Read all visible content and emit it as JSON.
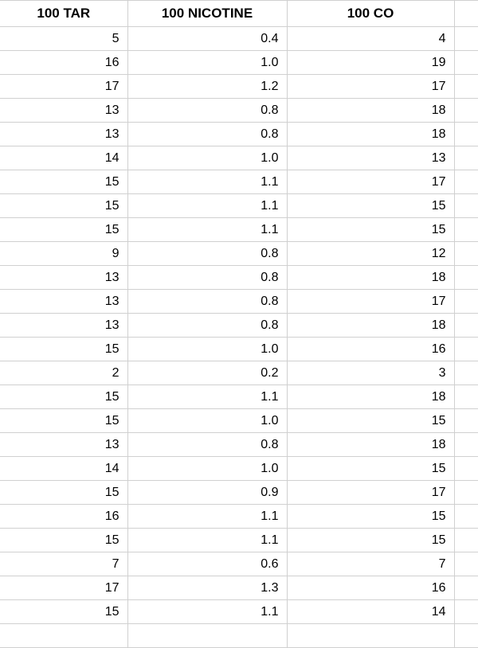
{
  "table": {
    "headers": [
      "100 TAR",
      "100 NICOTINE",
      "100 CO"
    ],
    "rows": [
      {
        "tar": "5",
        "nicotine": "0.4",
        "co": "4"
      },
      {
        "tar": "16",
        "nicotine": "1.0",
        "co": "19"
      },
      {
        "tar": "17",
        "nicotine": "1.2",
        "co": "17"
      },
      {
        "tar": "13",
        "nicotine": "0.8",
        "co": "18"
      },
      {
        "tar": "13",
        "nicotine": "0.8",
        "co": "18"
      },
      {
        "tar": "14",
        "nicotine": "1.0",
        "co": "13"
      },
      {
        "tar": "15",
        "nicotine": "1.1",
        "co": "17"
      },
      {
        "tar": "15",
        "nicotine": "1.1",
        "co": "15"
      },
      {
        "tar": "15",
        "nicotine": "1.1",
        "co": "15"
      },
      {
        "tar": "9",
        "nicotine": "0.8",
        "co": "12"
      },
      {
        "tar": "13",
        "nicotine": "0.8",
        "co": "18"
      },
      {
        "tar": "13",
        "nicotine": "0.8",
        "co": "17"
      },
      {
        "tar": "13",
        "nicotine": "0.8",
        "co": "18"
      },
      {
        "tar": "15",
        "nicotine": "1.0",
        "co": "16"
      },
      {
        "tar": "2",
        "nicotine": "0.2",
        "co": "3"
      },
      {
        "tar": "15",
        "nicotine": "1.1",
        "co": "18"
      },
      {
        "tar": "15",
        "nicotine": "1.0",
        "co": "15"
      },
      {
        "tar": "13",
        "nicotine": "0.8",
        "co": "18"
      },
      {
        "tar": "14",
        "nicotine": "1.0",
        "co": "15"
      },
      {
        "tar": "15",
        "nicotine": "0.9",
        "co": "17"
      },
      {
        "tar": "16",
        "nicotine": "1.1",
        "co": "15"
      },
      {
        "tar": "15",
        "nicotine": "1.1",
        "co": "15"
      },
      {
        "tar": "7",
        "nicotine": "0.6",
        "co": "7"
      },
      {
        "tar": "17",
        "nicotine": "1.3",
        "co": "16"
      },
      {
        "tar": "15",
        "nicotine": "1.1",
        "co": "14"
      }
    ]
  }
}
